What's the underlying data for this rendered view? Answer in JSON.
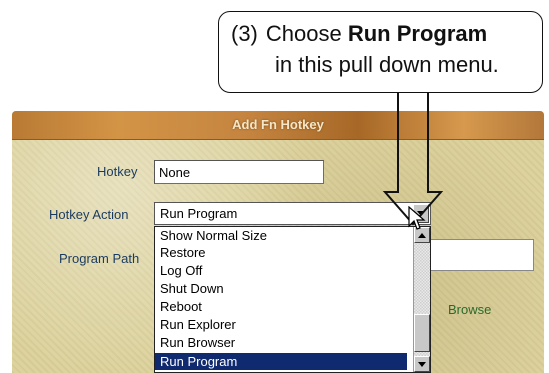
{
  "callout": {
    "number": "(3)",
    "line1_prefix": "Choose ",
    "line1_bold": "Run Program",
    "line2": "in this pull down menu."
  },
  "dialog": {
    "title": "Add Fn Hotkey",
    "hotkey_label": "Hotkey",
    "hotkey_value": "None",
    "action_label": "Hotkey Action",
    "action_value": "Run Program",
    "path_label": "Program Path",
    "path_value": "",
    "browse_label": "Browse",
    "dropdown_items": [
      "Show Normal Size",
      "Restore",
      "Log Off",
      "Shut Down",
      "Reboot",
      "Run Explorer",
      "Run Browser",
      "Run Program"
    ],
    "selected_index": 7
  },
  "colors": {
    "selection": "#0f2a6e",
    "label": "#1a3b5f",
    "browse": "#2b6a2b",
    "title_bar": "#b97a34"
  },
  "icons": {
    "cursor": "mouse-pointer-icon",
    "scroll_up": "chevron-up-icon",
    "scroll_down": "chevron-down-icon",
    "dropdown": "chevron-down-icon",
    "pointer_arrow": "down-arrow-icon"
  }
}
